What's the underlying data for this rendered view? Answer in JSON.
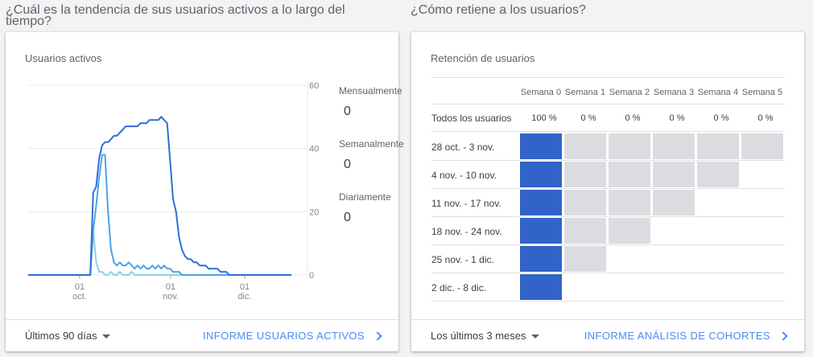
{
  "left_section": {
    "title": "¿Cuál es la tendencia de sus usuarios activos a lo largo del tiempo?",
    "card_title": "Usuarios activos",
    "y_ticks": [
      "60",
      "40",
      "20",
      "0"
    ],
    "x_ticks": [
      {
        "day": "01",
        "month": "oct."
      },
      {
        "day": "01",
        "month": "nov."
      },
      {
        "day": "01",
        "month": "dic."
      }
    ],
    "metrics": [
      {
        "label": "Mensualmente",
        "value": "0"
      },
      {
        "label": "Semanalmente",
        "value": "0"
      },
      {
        "label": "Diariamente",
        "value": "0"
      }
    ],
    "footer_select": "Últimos 90 días",
    "footer_link": "INFORME USUARIOS ACTIVOS"
  },
  "chart_data": {
    "type": "line",
    "ylim": [
      0,
      60
    ],
    "y_ticks": [
      0,
      20,
      40,
      60
    ],
    "series": [
      {
        "name": "Mensualmente",
        "color": "#2f6fd6",
        "values": [
          0,
          0,
          0,
          0,
          0,
          0,
          0,
          0,
          0,
          0,
          0,
          0,
          0,
          0,
          0,
          0,
          0,
          0,
          0,
          0,
          0,
          0,
          26,
          28,
          37,
          41,
          42,
          42,
          43,
          44,
          44,
          45,
          46,
          47,
          47,
          47,
          47,
          47,
          48,
          48,
          48,
          49,
          49,
          49,
          49,
          50,
          49,
          48,
          36,
          24,
          20,
          12,
          8,
          6,
          5,
          5,
          4,
          4,
          3,
          3,
          3,
          2,
          2,
          2,
          2,
          1,
          1,
          1,
          0,
          0,
          0,
          0,
          0,
          0,
          0,
          0,
          0,
          0,
          0,
          0,
          0,
          0,
          0,
          0,
          0,
          0,
          0,
          0,
          0,
          0
        ]
      },
      {
        "name": "Semanalmente",
        "color": "#4ea2e6",
        "values": [
          0,
          0,
          0,
          0,
          0,
          0,
          0,
          0,
          0,
          0,
          0,
          0,
          0,
          0,
          0,
          0,
          0,
          0,
          0,
          0,
          0,
          0,
          14,
          22,
          31,
          38,
          38,
          20,
          8,
          4,
          3,
          4,
          3,
          3,
          4,
          3,
          2,
          3,
          2,
          3,
          2,
          2,
          3,
          2,
          3,
          2,
          3,
          2,
          2,
          1,
          1,
          1,
          0,
          0,
          0,
          0,
          0,
          0,
          0,
          0,
          0,
          0,
          0,
          0,
          0,
          0,
          0,
          0,
          0,
          0,
          0,
          0,
          0,
          0,
          0,
          0,
          0,
          0,
          0,
          0,
          0,
          0,
          0,
          0,
          0,
          0,
          0,
          0,
          0,
          0
        ]
      },
      {
        "name": "Diariamente",
        "color": "#8fd0e6",
        "values": [
          0,
          0,
          0,
          0,
          0,
          0,
          0,
          0,
          0,
          0,
          0,
          0,
          0,
          0,
          0,
          0,
          0,
          0,
          0,
          0,
          0,
          0,
          14,
          4,
          1,
          1,
          0,
          0,
          1,
          0,
          0,
          1,
          0,
          0,
          0,
          1,
          0,
          0,
          0,
          0,
          0,
          0,
          0,
          0,
          0,
          0,
          0,
          0,
          0,
          0,
          0,
          0,
          0,
          0,
          0,
          0,
          0,
          0,
          0,
          0,
          0,
          0,
          0,
          0,
          0,
          0,
          0,
          0,
          0,
          0,
          0,
          0,
          0,
          0,
          0,
          0,
          0,
          0,
          0,
          0,
          0,
          0,
          0,
          0,
          0,
          0,
          0,
          0,
          0,
          0
        ]
      }
    ]
  },
  "right_section": {
    "title": "¿Cómo retiene a los usuarios?",
    "card_title": "Retención de usuarios",
    "headers": [
      "Semana 0",
      "Semana 1",
      "Semana 2",
      "Semana 3",
      "Semana 4",
      "Semana 5"
    ],
    "all_users_label": "Todos los usuarios",
    "all_users_pcts": [
      "100 %",
      "0 %",
      "0 %",
      "0 %",
      "0 %",
      "0 %"
    ],
    "cohorts": [
      {
        "label": "28 oct. - 3 nov.",
        "cells": 6
      },
      {
        "label": "4 nov. - 10 nov.",
        "cells": 5
      },
      {
        "label": "11 nov. - 17 nov.",
        "cells": 4
      },
      {
        "label": "18 nov. - 24 nov.",
        "cells": 3
      },
      {
        "label": "25 nov. - 1 dic.",
        "cells": 2
      },
      {
        "label": "2 dic. - 8 dic.",
        "cells": 1
      }
    ],
    "footer_select": "Los últimos 3 meses",
    "footer_link": "INFORME ANÁLISIS DE COHORTES"
  },
  "colors": {
    "accent": "#4a8af4",
    "retention_filled": "#3163c9",
    "retention_empty": "#dadce0"
  }
}
